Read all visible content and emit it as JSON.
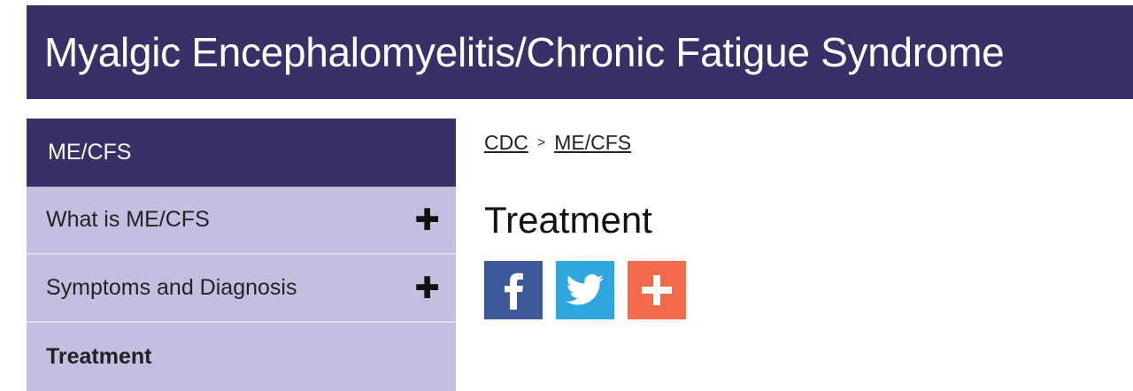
{
  "banner": {
    "title": "Myalgic Encephalomyelitis/Chronic Fatigue Syndrome"
  },
  "sidebar": {
    "header": "ME/CFS",
    "items": [
      {
        "label": "What is ME/CFS",
        "expand_icon": "plus-icon"
      },
      {
        "label": "Symptoms and Diagnosis",
        "expand_icon": "plus-icon"
      },
      {
        "label": "Treatment",
        "active": true
      }
    ]
  },
  "breadcrumb": {
    "items": [
      "CDC",
      "ME/CFS"
    ],
    "separator": ">"
  },
  "page": {
    "title": "Treatment"
  },
  "share": {
    "buttons": [
      {
        "name": "facebook-icon",
        "color": "#3b5998"
      },
      {
        "name": "twitter-icon",
        "color": "#2ea7df"
      },
      {
        "name": "add-share-icon",
        "color": "#f26a4a"
      }
    ]
  },
  "colors": {
    "primary": "#3b2f68",
    "sidebar_item_bg": "#c4bfe0"
  }
}
